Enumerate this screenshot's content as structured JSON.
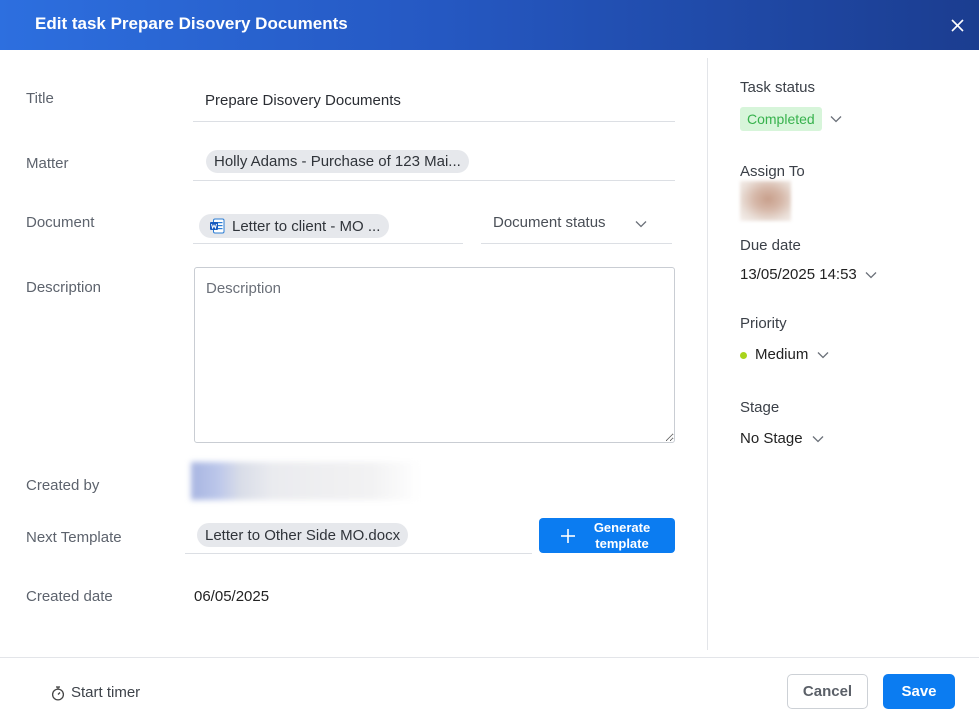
{
  "colors": {
    "accent": "#0b7cf1",
    "header_start": "#2d6fdf",
    "header_end": "#1b3d90",
    "status_completed_bg": "#d7f5da",
    "status_completed_text": "#37b24d",
    "priority_medium": "#a8d41c"
  },
  "dialog": {
    "title": "Edit task Prepare Disovery Documents",
    "close_icon": "close-icon"
  },
  "form": {
    "title": {
      "label": "Title",
      "value": "Prepare Disovery Documents"
    },
    "matter": {
      "label": "Matter",
      "value": "Holly Adams - Purchase of 123 Mai..."
    },
    "document": {
      "label": "Document",
      "value": "Letter to client - MO ...",
      "icon": "word-document-icon",
      "status_placeholder": "Document status"
    },
    "description": {
      "label": "Description",
      "placeholder": "Description"
    },
    "created_by": {
      "label": "Created by"
    },
    "next_template": {
      "label": "Next Template",
      "value": "Letter to Other Side MO.docx",
      "generate_label": "Generate template",
      "generate_icon": "plus-icon"
    },
    "created_date": {
      "label": "Created date",
      "value": "06/05/2025"
    }
  },
  "sidebar": {
    "task_status": {
      "label": "Task status",
      "value": "Completed"
    },
    "assign_to": {
      "label": "Assign To"
    },
    "due_date": {
      "label": "Due date",
      "value": "13/05/2025 14:53"
    },
    "priority": {
      "label": "Priority",
      "value": "Medium"
    },
    "stage": {
      "label": "Stage",
      "value": "No Stage"
    }
  },
  "footer": {
    "start_timer_label": "Start timer",
    "start_timer_icon": "stopwatch-icon",
    "cancel_label": "Cancel",
    "save_label": "Save"
  }
}
